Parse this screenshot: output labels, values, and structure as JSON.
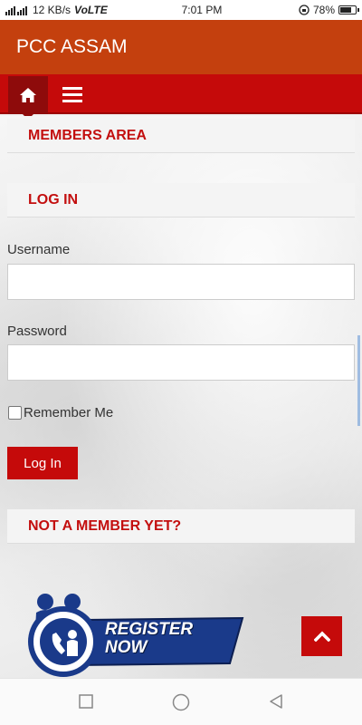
{
  "status_bar": {
    "network": "12 KB/s",
    "volte": "VoLTE",
    "time": "7:01 PM",
    "battery": "78%"
  },
  "app_bar": {
    "title": "PCC ASSAM"
  },
  "nav": {
    "home_icon": "home-icon",
    "menu_icon": "hamburger-menu-icon"
  },
  "members_area": {
    "title": "MEMBERS AREA"
  },
  "login": {
    "title": "LOG IN",
    "username_label": "Username",
    "username_value": "",
    "password_label": "Password",
    "password_value": "",
    "remember_label": "Remember Me",
    "remember_checked": false,
    "submit_label": "Log In"
  },
  "not_member": {
    "title": "NOT A MEMBER YET?"
  },
  "register": {
    "line1": "REGISTER",
    "line2": "NOW"
  },
  "colors": {
    "app_bar": "#c4400e",
    "nav_bar": "#c50a0a",
    "accent_text": "#c30f0f",
    "register_blue": "#1a3a8a"
  }
}
